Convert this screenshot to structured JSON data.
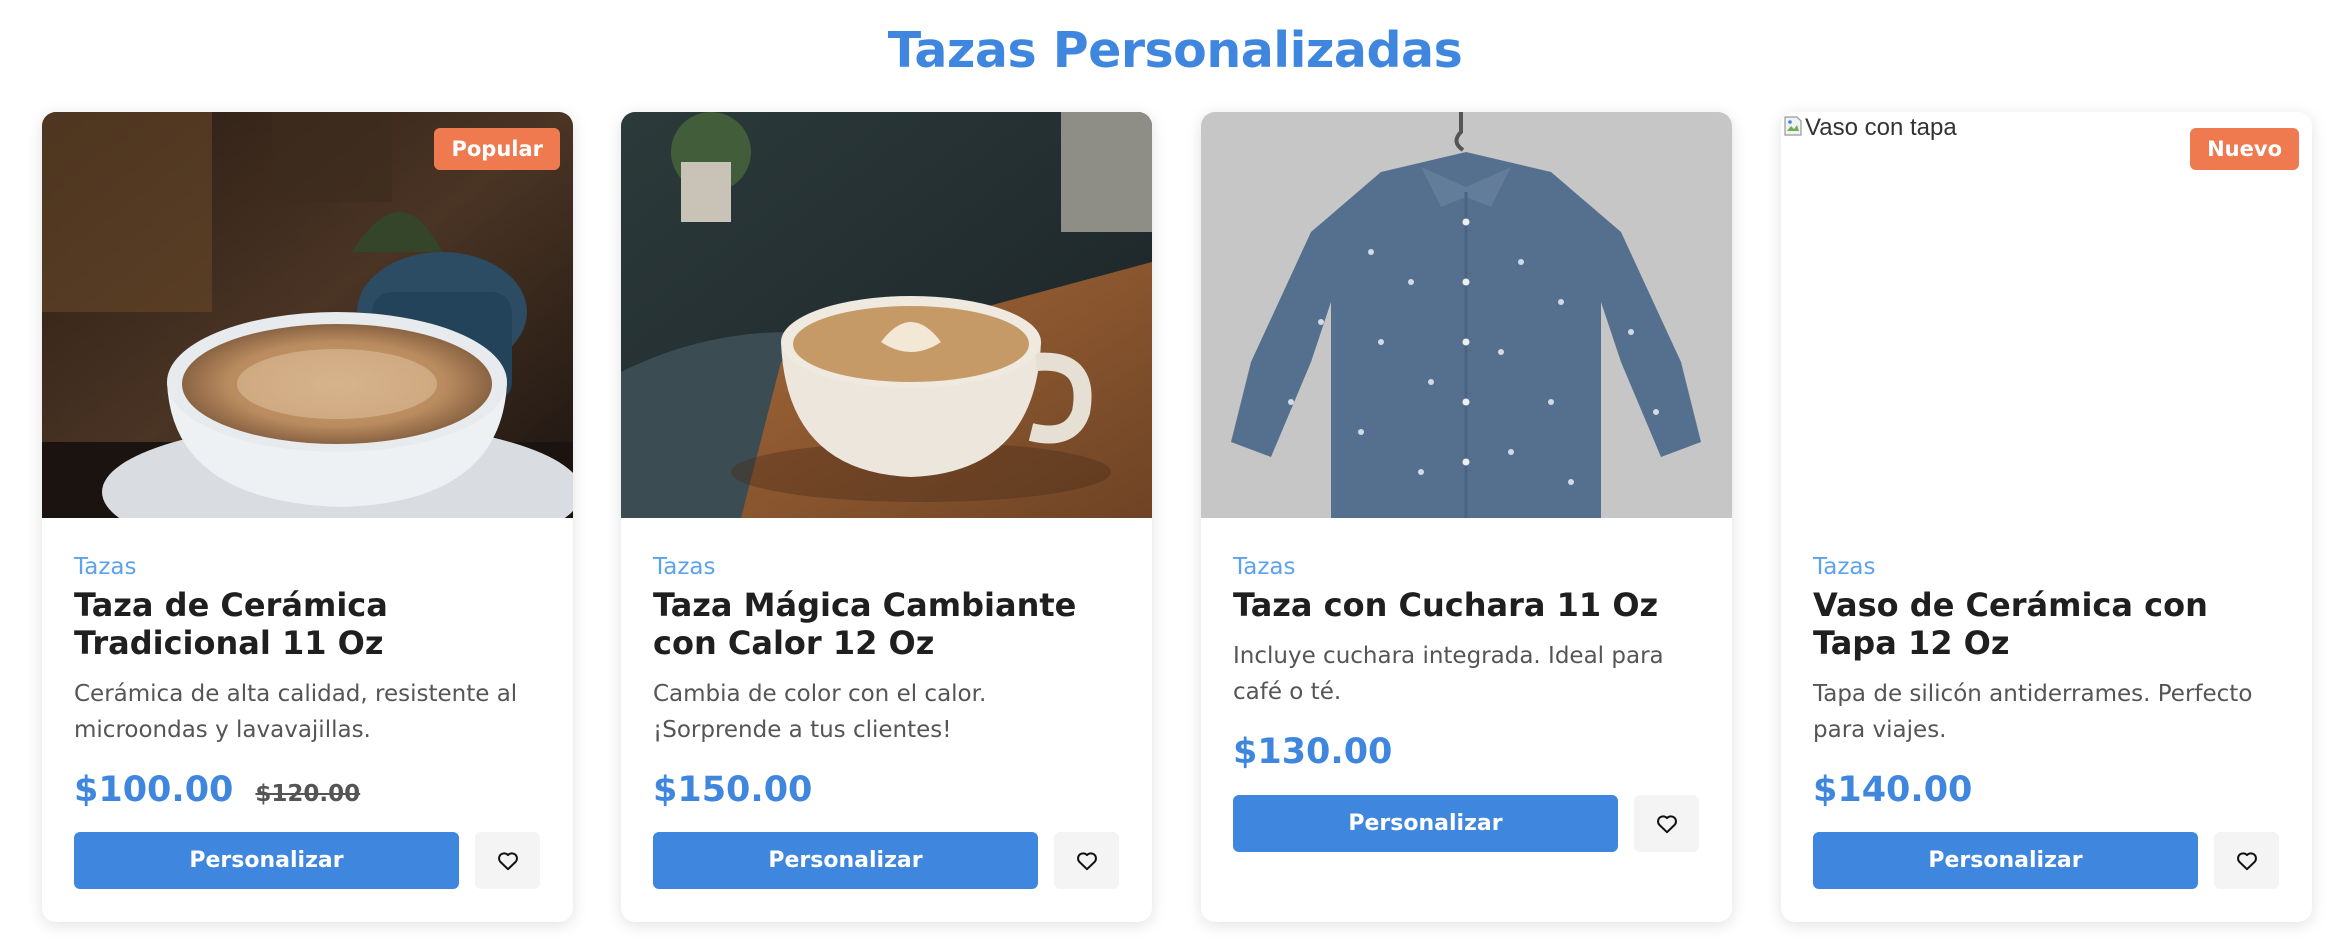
{
  "page": {
    "title": "Tazas Personalizadas"
  },
  "colors": {
    "accent": "#3f86df",
    "badge": "#ef7a4f",
    "category": "#5da2ec"
  },
  "icons": {
    "favorite": "heart-icon",
    "broken_image": "broken-image-icon"
  },
  "products": [
    {
      "badge": "Popular",
      "category": "Tazas",
      "name": "Taza de Cerámica Tradicional 11 Oz",
      "description": "Cerámica de alta calidad, resistente al microondas y lavavajillas.",
      "price": "$100.00",
      "old_price": "$120.00",
      "button": "Personalizar"
    },
    {
      "category": "Tazas",
      "name": "Taza Mágica Cambiante con Calor 12 Oz",
      "description": "Cambia de color con el calor. ¡Sorprende a tus clientes!",
      "price": "$150.00",
      "button": "Personalizar"
    },
    {
      "category": "Tazas",
      "name": "Taza con Cuchara 11 Oz",
      "description": "Incluye cuchara integrada. Ideal para café o té.",
      "price": "$130.00",
      "button": "Personalizar"
    },
    {
      "badge": "Nuevo",
      "image_alt": "Vaso con tapa",
      "category": "Tazas",
      "name": "Vaso de Cerámica con Tapa 12 Oz",
      "description": "Tapa de silicón antiderrames. Perfecto para viajes.",
      "price": "$140.00",
      "button": "Personalizar"
    }
  ]
}
